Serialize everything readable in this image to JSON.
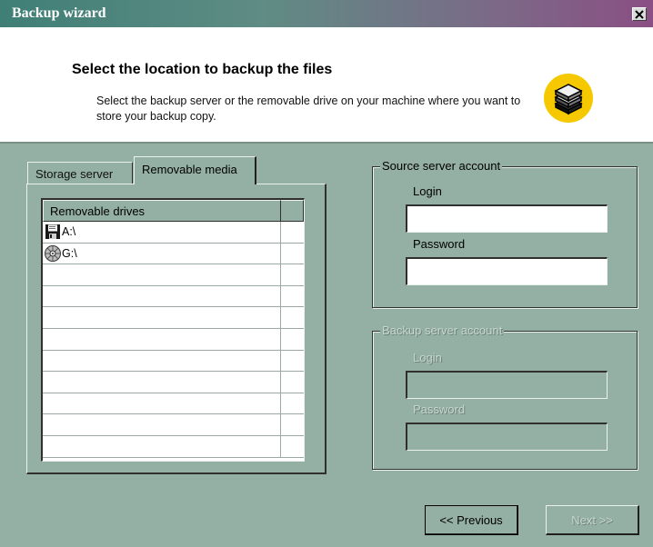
{
  "window": {
    "title": "Backup wizard",
    "close_glyph": "✕"
  },
  "header": {
    "heading": "Select the location to backup the files",
    "description": "Select the backup server or the removable drive on your machine where you want to store your backup copy.",
    "logo_icon": "server-stack-icon"
  },
  "tabs": [
    {
      "label": "Storage server",
      "active": false
    },
    {
      "label": "Removable media",
      "active": true
    }
  ],
  "drives": {
    "column_header": "Removable drives",
    "items": [
      {
        "label": "A:\\",
        "icon": "floppy-disk-icon"
      },
      {
        "label": "G:\\",
        "icon": "cd-rom-icon"
      }
    ]
  },
  "source_account": {
    "title": "Source server account",
    "login_label": "Login",
    "login_value": "",
    "password_label": "Password",
    "password_value": ""
  },
  "backup_account": {
    "title": "Backup server account",
    "login_label": "Login",
    "login_value": "",
    "password_label": "Password",
    "password_value": ""
  },
  "buttons": {
    "previous": "<< Previous",
    "next": "Next >>"
  }
}
